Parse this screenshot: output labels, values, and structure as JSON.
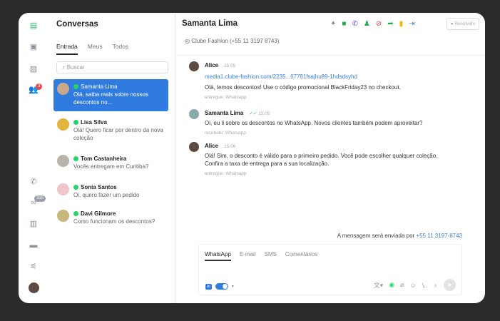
{
  "rail": {
    "contacts_badge": "3",
    "whatsapp_badge": "315"
  },
  "list": {
    "title": "Conversas",
    "tabs": [
      "Entrada",
      "Meus",
      "Todos"
    ],
    "search_placeholder": "Buscar",
    "items": [
      {
        "name": "Samanta Lima",
        "preview": "Olá, saiba mais sobre nossos descontos no..."
      },
      {
        "name": "Lisa Silva",
        "preview": "Olá! Quero ficar por dentro da nova coleção"
      },
      {
        "name": "Tom Castanheira",
        "preview": "Vocês entregam em Curitiba?"
      },
      {
        "name": "Sonia Santos",
        "preview": "Oi, quero fazer um pedido"
      },
      {
        "name": "Davi Gilmore",
        "preview": "Como funcionam os descontos?"
      }
    ]
  },
  "header": {
    "name": "Samanta Lima",
    "subtitle": "Clube Fashion (+55 11 3197 8743)",
    "resolve": "Resolvido"
  },
  "messages": [
    {
      "author": "Alice",
      "time": "15:05",
      "link": "media1.clube-fashion.com/2235...67781fsajhu89-1hdsdsyhd",
      "text": "Olá, temos descontos! Use o código promocional BlackFriday23 no checkout.",
      "meta": "entregue: Whatsapp"
    },
    {
      "author": "Samanta Lima",
      "time": "15:05",
      "text": "Oi, eu li sobre os descontos no WhatsApp. Novos clientes também podem aproveitar?",
      "meta": "recebido: Whatsapp"
    },
    {
      "author": "Alice",
      "time": "15:06",
      "text": "Olá! Sim, o desconto é válido para o primeiro pedido. Você pode escolher qualquer coleção. Confira a taxa de entrega para a sua localização.",
      "meta": "entregue: Whatsapp"
    }
  ],
  "composer": {
    "send_info": "A mensagem será enviada por ",
    "send_number": "+55 11 3197-8743",
    "tabs": [
      "WhatsApp",
      "E-mail",
      "SMS",
      "Comentários"
    ]
  }
}
